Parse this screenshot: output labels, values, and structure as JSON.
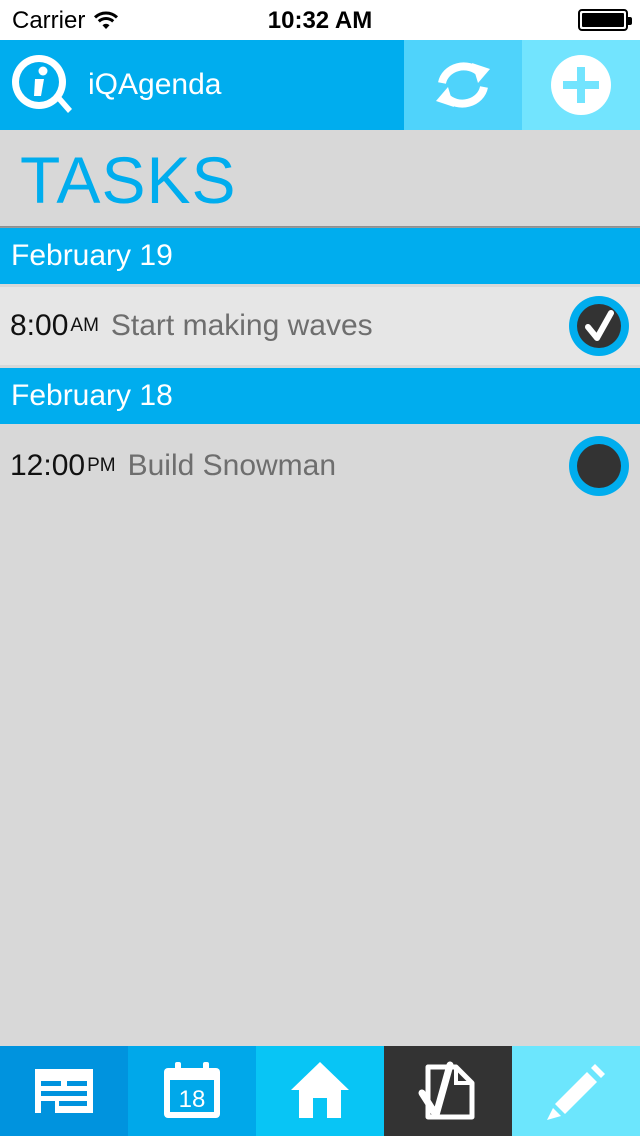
{
  "status_bar": {
    "carrier": "Carrier",
    "time": "10:32 AM",
    "battery_level": 1.0
  },
  "header": {
    "app_name": "iQAgenda",
    "logo_icon": "iq-logo-icon",
    "sync_icon": "sync-icon",
    "add_icon": "add-icon"
  },
  "page": {
    "title": "TASKS"
  },
  "task_groups": [
    {
      "date": "February 19",
      "tasks": [
        {
          "time": "8:00",
          "ampm": "AM",
          "title": "Start making waves",
          "completed": true
        }
      ]
    },
    {
      "date": "February 18",
      "tasks": [
        {
          "time": "12:00",
          "ampm": "PM",
          "title": "Build Snowman",
          "completed": false
        }
      ]
    }
  ],
  "tabbar": {
    "items": [
      {
        "icon": "agenda-icon",
        "color": "#0093de",
        "selected": false
      },
      {
        "icon": "calendar-icon",
        "label": "18",
        "color": "#00a8ea",
        "selected": false
      },
      {
        "icon": "home-icon",
        "color": "#08c5f5",
        "selected": false
      },
      {
        "icon": "tasks-icon",
        "color": "#333333",
        "selected": true
      },
      {
        "icon": "notes-pencil-icon",
        "color": "#6ce6fd",
        "selected": false
      }
    ]
  },
  "colors": {
    "accent": "#00adee",
    "background": "#d8d8d8",
    "completed_row": "#e6e6e6",
    "check_ring": "#00adee",
    "check_fill": "#333333"
  }
}
